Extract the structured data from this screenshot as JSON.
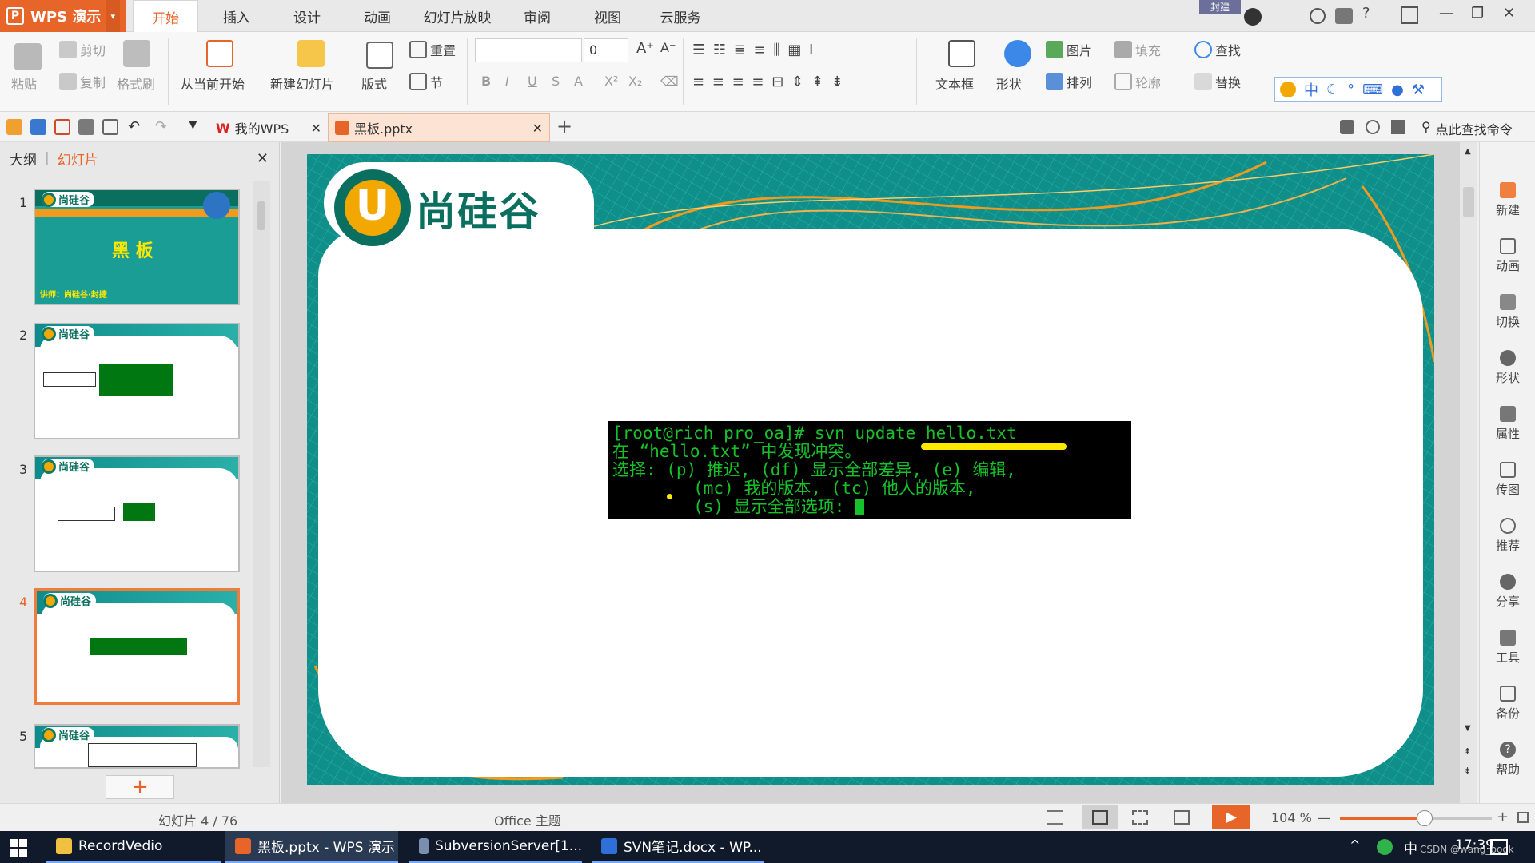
{
  "titlebar": {
    "app_name": "WPS 演示",
    "app_caret": "▾",
    "tabs": [
      "开始",
      "插入",
      "设计",
      "动画",
      "幻灯片放映",
      "审阅",
      "视图",
      "云服务"
    ],
    "badge_text": "封建",
    "window_controls": {
      "minimize": "—",
      "restore": "❐",
      "close": "✕"
    },
    "help": "?"
  },
  "ribbon": {
    "paste": "粘贴",
    "cut": "剪切",
    "copy": "复制",
    "format_painter": "格式刷",
    "from_current": "从当前开始",
    "new_slide": "新建幻灯片",
    "layout": "版式",
    "reset": "重置",
    "section": "节",
    "font_size_value": "0",
    "bold": "B",
    "italic": "I",
    "underline": "U",
    "strike": "S",
    "fontcolor": "A",
    "superscript": "X²",
    "subscript": "X₂",
    "textbox": "文本框",
    "shape": "形状",
    "picture": "图片",
    "fill": "填充",
    "arrange": "排列",
    "outline": "轮廓",
    "find": "查找",
    "replace": "替换",
    "ime_chinese": "中"
  },
  "quickbar": {
    "doc_tabs": [
      {
        "label": "我的WPS",
        "close": "✕"
      },
      {
        "label": "黑板.pptx",
        "close": "✕"
      }
    ],
    "add_tab": "+",
    "search_cmd": "点此查找命令"
  },
  "leftpanel": {
    "tab_outline": "大纲",
    "tab_slides": "幻灯片",
    "close": "✕",
    "slides": [
      {
        "num": "1",
        "title": "黑 板",
        "subtitle": "讲师：尚硅谷·封捷"
      },
      {
        "num": "2"
      },
      {
        "num": "3"
      },
      {
        "num": "4"
      },
      {
        "num": "5"
      }
    ],
    "add_button": "+"
  },
  "slide": {
    "brand": "尚硅谷",
    "brand_letter": "U",
    "terminal_lines": [
      "[root@rich pro_oa]# svn update hello.txt",
      "在 “hello.txt” 中发现冲突。",
      "选择: (p) 推迟, (df) 显示全部差异, (e) 编辑,",
      "        (mc) 我的版本, (tc) 他人的版本,",
      "        (s) 显示全部选项: "
    ]
  },
  "sidebar": {
    "items": [
      "新建",
      "动画",
      "切换",
      "形状",
      "属性",
      "传图",
      "推荐",
      "分享",
      "工具",
      "备份",
      "帮助"
    ]
  },
  "statusbar": {
    "slide_info": "幻灯片 4 / 76",
    "theme": "Office 主题",
    "zoom": "104 %",
    "zoom_minus": "—",
    "zoom_plus": "+",
    "zoom_fraction": 0.56
  },
  "taskbar": {
    "items": [
      "RecordVedio",
      "黑板.pptx - WPS 演示",
      "SubversionServer[1...",
      "SVN笔记.docx - WP..."
    ],
    "ime": "中",
    "time": "17:39",
    "watermark": "CSDN @wang_book"
  },
  "colors": {
    "accent": "#e8652a",
    "teal": "#0f8e8a",
    "terminal_green": "#16c22a",
    "highlight": "#ffe700"
  }
}
